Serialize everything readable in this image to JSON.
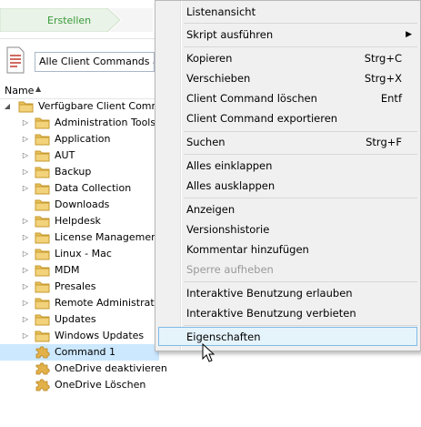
{
  "toolbar": {
    "create_label": "Erstellen"
  },
  "filter": {
    "value": "Alle Client Commands anze"
  },
  "column_header": {
    "name_label": "Name"
  },
  "tree": {
    "root_label": "Verfügbare Client Command",
    "folders": [
      {
        "label": "Administration Tools",
        "expandable": true
      },
      {
        "label": "Application",
        "expandable": true
      },
      {
        "label": "AUT",
        "expandable": true
      },
      {
        "label": "Backup",
        "expandable": true
      },
      {
        "label": "Data Collection",
        "expandable": true
      },
      {
        "label": "Downloads",
        "expandable": false
      },
      {
        "label": "Helpdesk",
        "expandable": true
      },
      {
        "label": "License Management",
        "expandable": true
      },
      {
        "label": "Linux - Mac",
        "expandable": true
      },
      {
        "label": "MDM",
        "expandable": true
      },
      {
        "label": "Presales",
        "expandable": true
      },
      {
        "label": "Remote Administration",
        "expandable": true
      },
      {
        "label": "Updates",
        "expandable": true
      },
      {
        "label": "Windows Updates",
        "expandable": true
      }
    ],
    "commands": [
      {
        "label": "Command 1",
        "selected": true
      },
      {
        "label": "OneDrive deaktivieren",
        "selected": false
      },
      {
        "label": "OneDrive Löschen",
        "selected": false
      }
    ]
  },
  "context_menu": {
    "items": [
      {
        "label": "Listenansicht",
        "shortcut": "",
        "disabled": false
      },
      {
        "label": "Skript ausführen",
        "shortcut": "",
        "submenu": true,
        "disabled": false
      },
      {
        "label": "Kopieren",
        "shortcut": "Strg+C",
        "disabled": false
      },
      {
        "label": "Verschieben",
        "shortcut": "Strg+X",
        "disabled": false
      },
      {
        "label": "Client Command löschen",
        "shortcut": "Entf",
        "disabled": false
      },
      {
        "label": "Client Command exportieren",
        "shortcut": "",
        "disabled": false
      },
      {
        "label": "Suchen",
        "shortcut": "Strg+F",
        "disabled": false
      },
      {
        "label": "Alles einklappen",
        "shortcut": "",
        "disabled": false
      },
      {
        "label": "Alles ausklappen",
        "shortcut": "",
        "disabled": false
      },
      {
        "label": "Anzeigen",
        "shortcut": "",
        "disabled": false
      },
      {
        "label": "Versionshistorie",
        "shortcut": "",
        "disabled": false
      },
      {
        "label": "Kommentar hinzufügen",
        "shortcut": "",
        "disabled": false
      },
      {
        "label": "Sperre aufheben",
        "shortcut": "",
        "disabled": true
      },
      {
        "label": "Interaktive Benutzung erlauben",
        "shortcut": "",
        "disabled": false
      },
      {
        "label": "Interaktive Benutzung verbieten",
        "shortcut": "",
        "disabled": false
      },
      {
        "label": "Eigenschaften",
        "shortcut": "",
        "disabled": false,
        "highlighted": true
      }
    ]
  },
  "colors": {
    "create_text": "#3a9a3a",
    "selection": "#cce8ff",
    "menu_highlight": "#e5f3fb",
    "folder": "#e8c25c"
  }
}
